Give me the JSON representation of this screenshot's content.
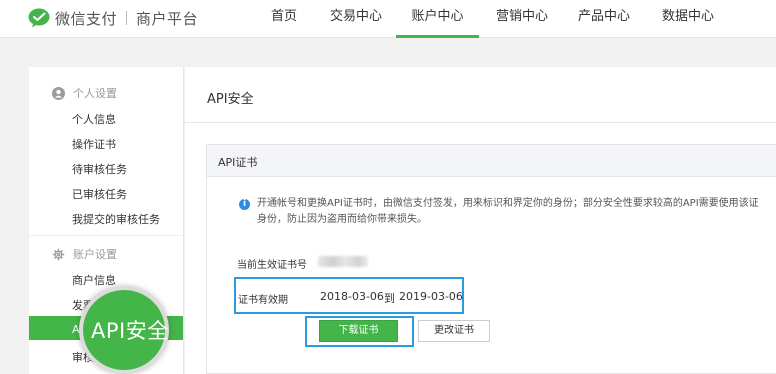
{
  "header": {
    "brand_name": "微信支付",
    "brand_sub": "商户平台",
    "nav": [
      {
        "label": "首页"
      },
      {
        "label": "交易中心"
      },
      {
        "label": "账户中心"
      },
      {
        "label": "营销中心"
      },
      {
        "label": "产品中心"
      },
      {
        "label": "数据中心"
      }
    ],
    "active_nav": "账户中心"
  },
  "sidebar": {
    "group1": {
      "label": "个人设置",
      "icon": "user-icon",
      "items": [
        "个人信息",
        "操作证书",
        "待审核任务",
        "已审核任务",
        "我提交的审核任务"
      ]
    },
    "group2": {
      "label": "账户设置",
      "icon": "gear-icon",
      "items": [
        "商户信息",
        "发票",
        "API安全",
        "审核"
      ]
    },
    "active_item": "API安全"
  },
  "magnifier": {
    "label": "API安全"
  },
  "main": {
    "title": "API安全",
    "card": {
      "title": "API证书",
      "info_line1": "开通帐号和更换API证书时，由微信支付签发，用来标识和界定你的身份；部分安全性要求较高的API需要使用该证",
      "info_line2": "身份，防止因为盗用而给你带来损失。",
      "cert_no_label": "当前生效证书号",
      "validity_label": "证书有效期",
      "validity_from": "2018-03-06",
      "validity_to_word": "到",
      "validity_to": "2019-03-06",
      "download_button": "下载证书",
      "change_button": "更改证书"
    }
  },
  "colors": {
    "accent_green": "#44b549",
    "highlight_blue": "#2b9be0",
    "info_blue": "#2b8be6"
  }
}
